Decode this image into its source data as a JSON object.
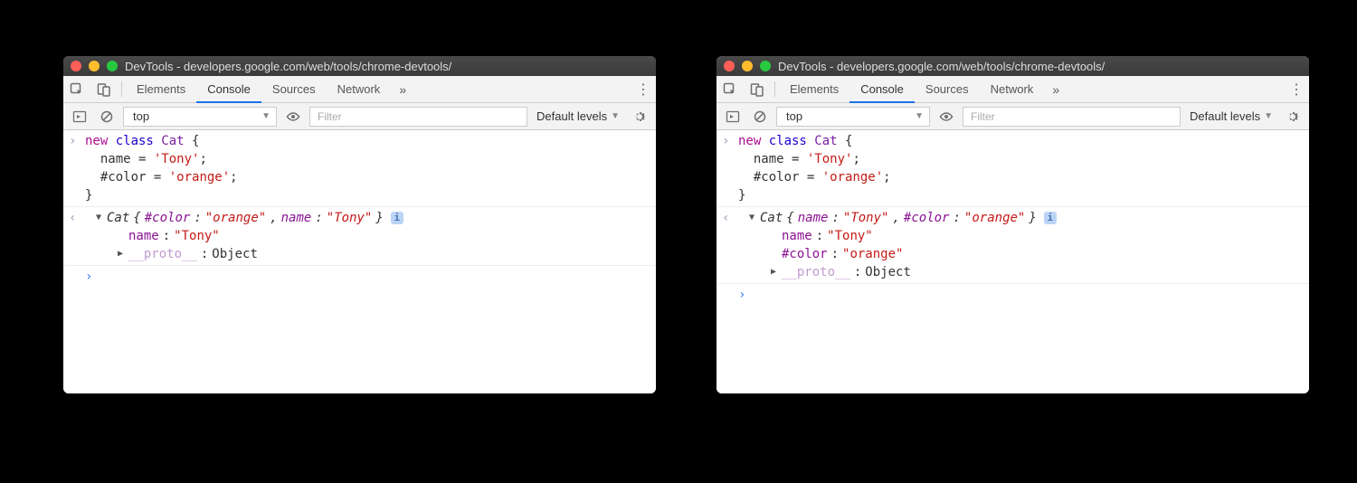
{
  "windows": [
    {
      "title": "DevTools - developers.google.com/web/tools/chrome-devtools/",
      "tabs": {
        "elements": "Elements",
        "console": "Console",
        "sources": "Sources",
        "network": "Network",
        "active": "Console"
      },
      "toolbar": {
        "context": "top",
        "filter_placeholder": "Filter",
        "levels": "Default levels"
      },
      "input_code": "new class Cat {\n  name = 'Tony';\n  #color = 'orange';\n}",
      "output": {
        "class_name": "Cat",
        "summary_props": [
          {
            "key": "#color",
            "value": "\"orange\""
          },
          {
            "key": "name",
            "value": "\"Tony\""
          }
        ],
        "expanded_props": [
          {
            "key": "name",
            "value": "\"Tony\"",
            "type": "string"
          }
        ],
        "proto": {
          "key": "__proto__",
          "value": "Object"
        }
      }
    },
    {
      "title": "DevTools - developers.google.com/web/tools/chrome-devtools/",
      "tabs": {
        "elements": "Elements",
        "console": "Console",
        "sources": "Sources",
        "network": "Network",
        "active": "Console"
      },
      "toolbar": {
        "context": "top",
        "filter_placeholder": "Filter",
        "levels": "Default levels"
      },
      "input_code": "new class Cat {\n  name = 'Tony';\n  #color = 'orange';\n}",
      "output": {
        "class_name": "Cat",
        "summary_props": [
          {
            "key": "name",
            "value": "\"Tony\""
          },
          {
            "key": "#color",
            "value": "\"orange\""
          }
        ],
        "expanded_props": [
          {
            "key": "name",
            "value": "\"Tony\"",
            "type": "string"
          },
          {
            "key": "#color",
            "value": "\"orange\"",
            "type": "string"
          }
        ],
        "proto": {
          "key": "__proto__",
          "value": "Object"
        }
      }
    }
  ],
  "glyphs": {
    "prompt_in": "›",
    "prompt_out": "‹",
    "disclose_right": "▶",
    "disclose_down": "▼",
    "more": "»",
    "info": "i",
    "kebab": "⋮",
    "chev_down": "▼"
  }
}
